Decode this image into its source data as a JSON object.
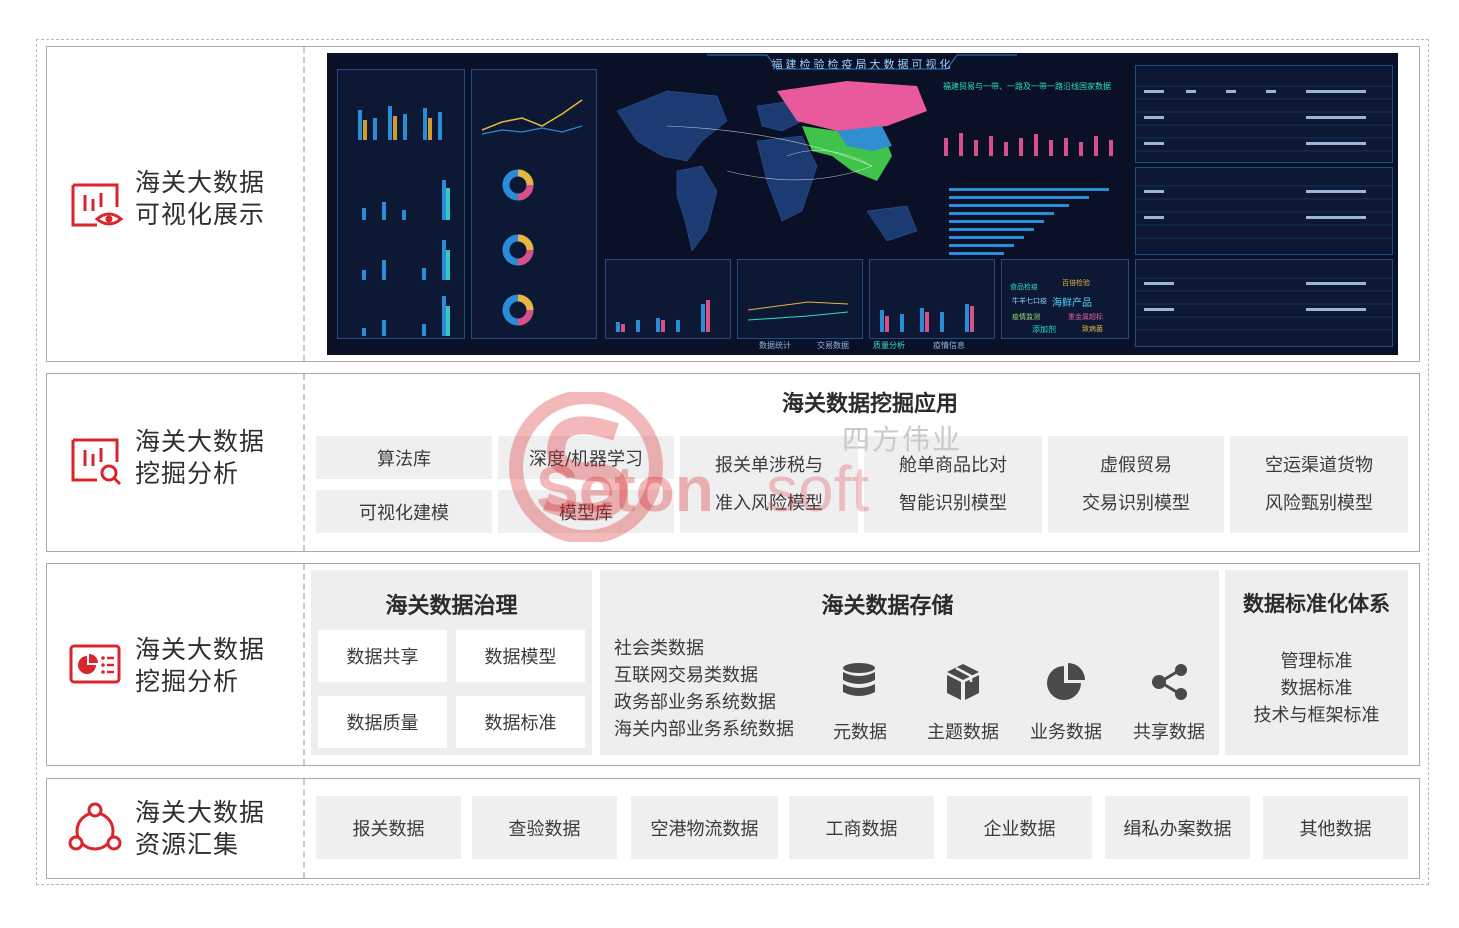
{
  "rows": [
    {
      "label_line1": "海关大数据",
      "label_line2": "可视化展示",
      "icon": "chart-eye-icon"
    },
    {
      "label_line1": "海关大数据",
      "label_line2": "挖掘分析",
      "icon": "chart-search-icon"
    },
    {
      "label_line1": "海关大数据",
      "label_line2": "挖掘分析",
      "icon": "pie-list-card-icon"
    },
    {
      "label_line1": "海关大数据",
      "label_line2": "资源汇集",
      "icon": "network-nodes-icon"
    }
  ],
  "dashboard": {
    "title": "福建检验检疫局大数据可视化",
    "map_title": "福建贸易与一带、一路及一带一路沿线国家数据",
    "tabs": [
      "数据统计",
      "交易数据",
      "质量分析",
      "疫情信息"
    ],
    "words": [
      "食品检疫",
      "百倍检验",
      "牛羊七口疫",
      "海鲜产品",
      "疫情监测",
      "重金属超标",
      "添加剂",
      "致病菌"
    ]
  },
  "mining": {
    "title": "海关数据挖掘应用",
    "left_boxes": [
      [
        "算法库",
        "深度/机器学习"
      ],
      [
        "可视化建模",
        "模型库"
      ]
    ],
    "models": [
      [
        "报关单涉税与",
        "准入风险模型"
      ],
      [
        "舱单商品比对",
        "智能识别模型"
      ],
      [
        "虚假贸易",
        "交易识别模型"
      ],
      [
        "空运渠道货物",
        "风险甄别模型"
      ]
    ]
  },
  "governance": {
    "title": "海关数据治理",
    "items": [
      "数据共享",
      "数据模型",
      "数据质量",
      "数据标准"
    ]
  },
  "storage": {
    "title": "海关数据存储",
    "sources": [
      "社会类数据",
      "互联网交易类数据",
      "政务部业务系统数据",
      "海关内部业务系统数据"
    ],
    "types": [
      {
        "label": "元数据",
        "icon": "database-icon"
      },
      {
        "label": "主题数据",
        "icon": "cube-icon"
      },
      {
        "label": "业务数据",
        "icon": "pie-chart-icon"
      },
      {
        "label": "共享数据",
        "icon": "share-icon"
      }
    ]
  },
  "standards": {
    "title": "数据标准化体系",
    "items": [
      "管理标准",
      "数据标准",
      "技术与框架标准"
    ]
  },
  "resources": [
    "报关数据",
    "查验数据",
    "空港物流数据",
    "工商数据",
    "企业数据",
    "缉私办案数据",
    "其他数据"
  ],
  "watermark": {
    "cn": "四方伟业",
    "en_dark": "Seton",
    "en_light": "soft"
  },
  "colors": {
    "accent": "#d9262c",
    "box_bg": "#efefef",
    "dash_bg": "#0a1026"
  }
}
